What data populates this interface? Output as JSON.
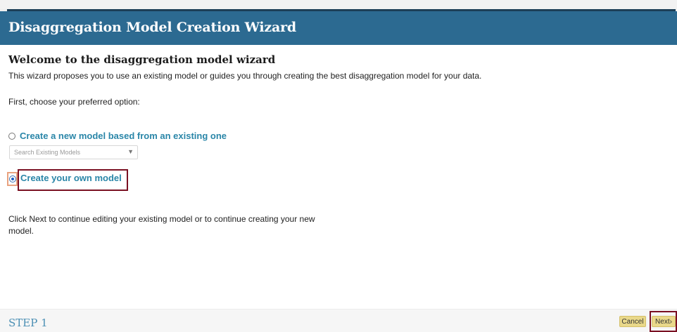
{
  "header": {
    "title": "Disaggregation Model Creation Wizard"
  },
  "intro": {
    "heading": "Welcome to the disaggregation model wizard",
    "description": "This wizard proposes you to use an existing model or guides you through creating the best disaggregation model for your data.",
    "prompt": "First, choose your preferred option:"
  },
  "options": {
    "existing_model": {
      "label": "Create a new model based from an existing one",
      "selected": false,
      "search_placeholder": "Search Existing Models"
    },
    "own_model": {
      "label": "Create your own model",
      "selected": true
    }
  },
  "note": "Click Next to continue editing your existing model or to continue creating your new model.",
  "footer": {
    "step": "STEP 1",
    "cancel_label": "Cancel",
    "next_label": "Next"
  },
  "colors": {
    "header_bg": "#2c6a91",
    "option_label": "#2a86a8",
    "button_bg": "#e9d88a",
    "highlight_outline": "#7a1022"
  }
}
